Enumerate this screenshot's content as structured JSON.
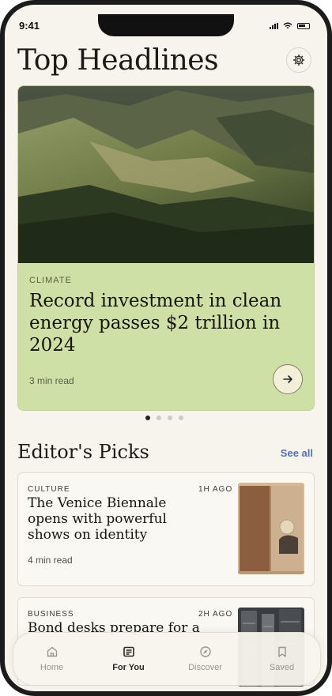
{
  "status": {
    "time": "9:41"
  },
  "page_title": "Top Headlines",
  "hero": {
    "category": "CLIMATE",
    "headline": "Record investment in clean energy passes $2 trillion in 2024",
    "read_time": "3 min read"
  },
  "carousel": {
    "count": 4,
    "active": 0
  },
  "section": {
    "title": "Editor's Picks",
    "see_all": "See all"
  },
  "picks": [
    {
      "category": "CULTURE",
      "time": "1H AGO",
      "headline": "The Venice Biennale opens with powerful shows on identity",
      "read_time": "4 min read"
    },
    {
      "category": "BUSINESS",
      "time": "2H AGO",
      "headline": "Bond desks prepare for a",
      "read_time": ""
    }
  ],
  "tabs": [
    {
      "label": "Home",
      "icon": "home-icon",
      "active": false
    },
    {
      "label": "For You",
      "icon": "newspaper-icon",
      "active": true
    },
    {
      "label": "Discover",
      "icon": "compass-icon",
      "active": false
    },
    {
      "label": "Saved",
      "icon": "bookmark-icon",
      "active": false
    }
  ],
  "colors": {
    "hero_bg": "#cfe0a6",
    "accent_link": "#4f72b4",
    "page_bg": "#f7f4ed"
  }
}
